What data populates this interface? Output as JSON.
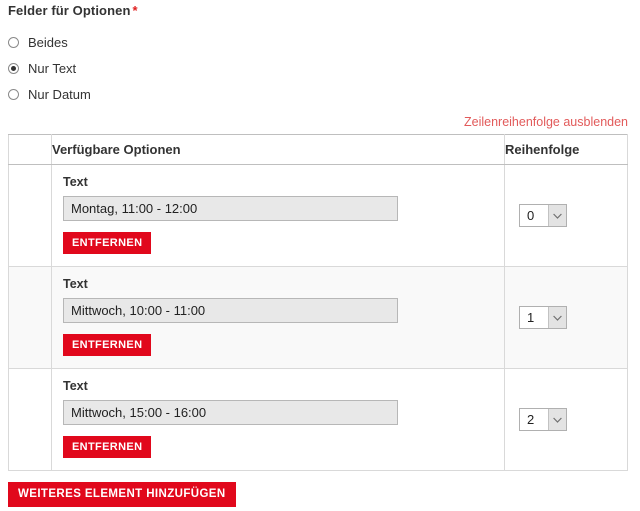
{
  "form": {
    "legend": "Felder für Optionen",
    "required_mark": "*",
    "radio_options": [
      {
        "label": "Beides",
        "checked": false
      },
      {
        "label": "Nur Text",
        "checked": true
      },
      {
        "label": "Nur Datum",
        "checked": false
      }
    ]
  },
  "row_weight_toggle": {
    "label": "Zeilenreihenfolge ausblenden"
  },
  "table": {
    "headers": {
      "handle": "",
      "options": "Verfügbare Optionen",
      "order": "Reihenfolge"
    },
    "rows": [
      {
        "sub_label": "Text",
        "value": "Montag, 11:00 - 12:00",
        "placeholder": "",
        "remove_label": "ENTFERNEN",
        "order_value": "0"
      },
      {
        "sub_label": "Text",
        "value": "Mittwoch, 10:00 - 11:00",
        "placeholder": "",
        "remove_label": "ENTFERNEN",
        "order_value": "1"
      },
      {
        "sub_label": "Text",
        "value": "Mittwoch, 15:00 - 16:00",
        "placeholder": "",
        "remove_label": "ENTFERNEN",
        "order_value": "2"
      }
    ]
  },
  "add_button": {
    "label": "WEITERES ELEMENT HINZUFÜGEN"
  },
  "colors": {
    "accent_red": "#e1081c",
    "link_red": "#e25a5a",
    "required_red": "#e02020",
    "input_bg": "#e8e8e8",
    "row_alt_bg": "#f9f9f9",
    "border": "#d9d9d9"
  }
}
